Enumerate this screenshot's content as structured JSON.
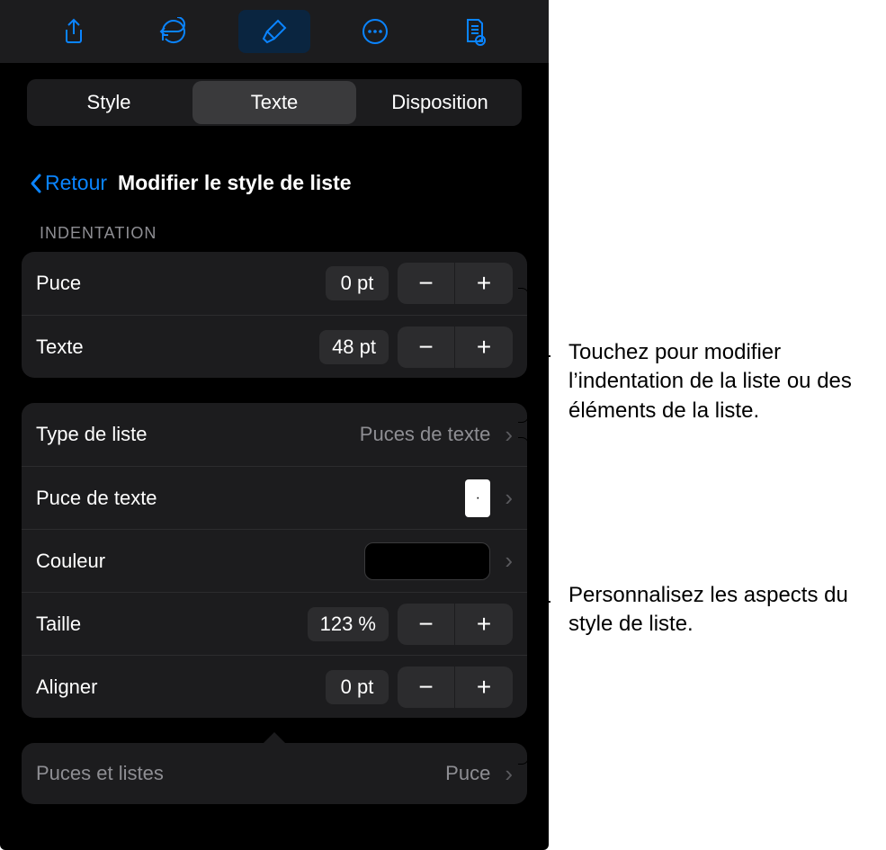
{
  "toolbar": {
    "icons": [
      "share-icon",
      "undo-icon",
      "brush-icon",
      "more-icon",
      "pages-icon"
    ]
  },
  "segmented": {
    "items": [
      "Style",
      "Texte",
      "Disposition"
    ],
    "active_index": 1
  },
  "nav": {
    "back_label": "Retour",
    "title": "Modifier le style de liste"
  },
  "indentation": {
    "section_label": "INDENTATION",
    "rows": [
      {
        "label": "Puce",
        "value": "0 pt"
      },
      {
        "label": "Texte",
        "value": "48 pt"
      }
    ]
  },
  "style": {
    "rows": {
      "list_type": {
        "label": "Type de liste",
        "value": "Puces de texte"
      },
      "text_bullet": {
        "label": "Puce de texte",
        "glyph": "·"
      },
      "color": {
        "label": "Couleur"
      },
      "size": {
        "label": "Taille",
        "value": "123 %"
      },
      "align": {
        "label": "Aligner",
        "value": "0 pt"
      }
    }
  },
  "bottom": {
    "label": "Puces et listes",
    "value": "Puce"
  },
  "callouts": {
    "c1": "Touchez pour modifier l’indentation de la liste ou des éléments de la liste.",
    "c2": "Personnalisez les aspects du style de liste."
  },
  "glyphs": {
    "minus": "−",
    "plus": "+",
    "chevron_right": "›"
  }
}
